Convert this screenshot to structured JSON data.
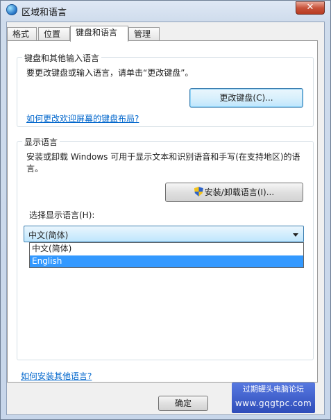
{
  "window": {
    "title": "区域和语言",
    "close_label": "✕"
  },
  "tabs": [
    {
      "label": "格式"
    },
    {
      "label": "位置"
    },
    {
      "label": "键盘和语言"
    },
    {
      "label": "管理"
    }
  ],
  "keyboard_group": {
    "title": "键盘和其他输入语言",
    "description": "要更改键盘或输入语言，请单击“更改键盘”。",
    "change_button": "更改键盘(C)...",
    "welcome_link": "如何更改欢迎屏幕的键盘布局?"
  },
  "display_group": {
    "title": "显示语言",
    "description_line1": "安装或卸载 Windows 可用于显示文本和识别语音和手写(在支持地区)的语",
    "description_line2": "言。",
    "install_button": "安装/卸载语言(I)...",
    "select_label": "选择显示语言(H):",
    "selected_value": "中文(简体)",
    "options": [
      "中文(简体)",
      "English"
    ],
    "highlighted_option": "English"
  },
  "footer": {
    "install_link": "如何安装其他语言?",
    "ok_button": "确定"
  },
  "watermark": {
    "text": "过期罐头电脑论坛",
    "url": "www.gqgtpc.com"
  },
  "colors": {
    "highlight": "#3399ff",
    "link": "#0066cc",
    "close": "#c7523a"
  }
}
